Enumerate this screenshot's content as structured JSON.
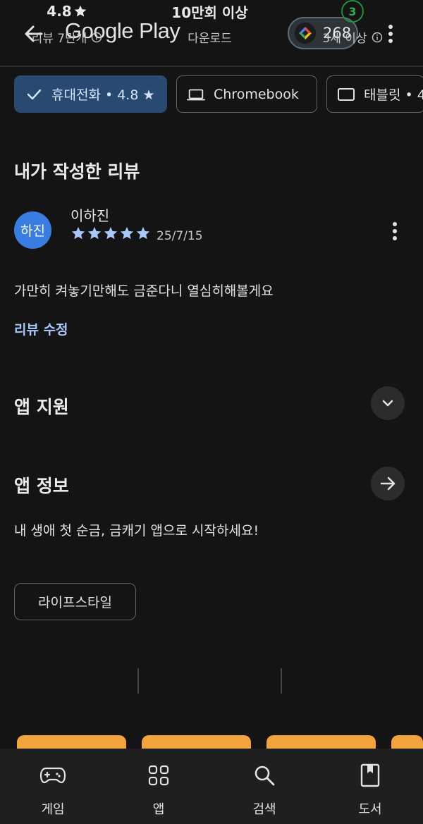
{
  "topbar": {
    "title": "Google Play",
    "points": "268"
  },
  "device_chips": [
    {
      "label": "휴대전화 • 4.8 ★",
      "icon": "check-icon",
      "selected": true
    },
    {
      "label": "Chromebook",
      "icon": "laptop-icon",
      "selected": false
    },
    {
      "label": "태블릿 • 4",
      "icon": "tablet-icon",
      "selected": false
    }
  ],
  "my_review": {
    "section_title": "내가 작성한 리뷰",
    "avatar_text": "하진",
    "reviewer_name": "이하진",
    "rating": 5,
    "date": "25/7/15",
    "text": "가만히 켜놓기만해도 금준다니 열심히해볼게요",
    "edit_label": "리뷰 수정"
  },
  "app_support": {
    "title": "앱 지원"
  },
  "app_info": {
    "title": "앱 정보",
    "description": "내 생애 첫 순금, 금캐기 앱으로 시작하세요!",
    "category_tag": "라이프스타일"
  },
  "stats": {
    "rating_value": "4.8",
    "rating_label": "리뷰 7만개",
    "downloads_value": "10만회 이상",
    "downloads_label": "다운로드",
    "age_value": "3",
    "age_label": "3세 이상"
  },
  "colors": {
    "accent": "#294a70",
    "link": "#a8c7fa",
    "age_green": "#34a853",
    "background": "#141414"
  },
  "bottom_nav": [
    {
      "label": "게임",
      "icon": "gamepad-icon"
    },
    {
      "label": "앱",
      "icon": "apps-grid-icon"
    },
    {
      "label": "검색",
      "icon": "search-icon"
    },
    {
      "label": "도서",
      "icon": "book-icon"
    }
  ]
}
